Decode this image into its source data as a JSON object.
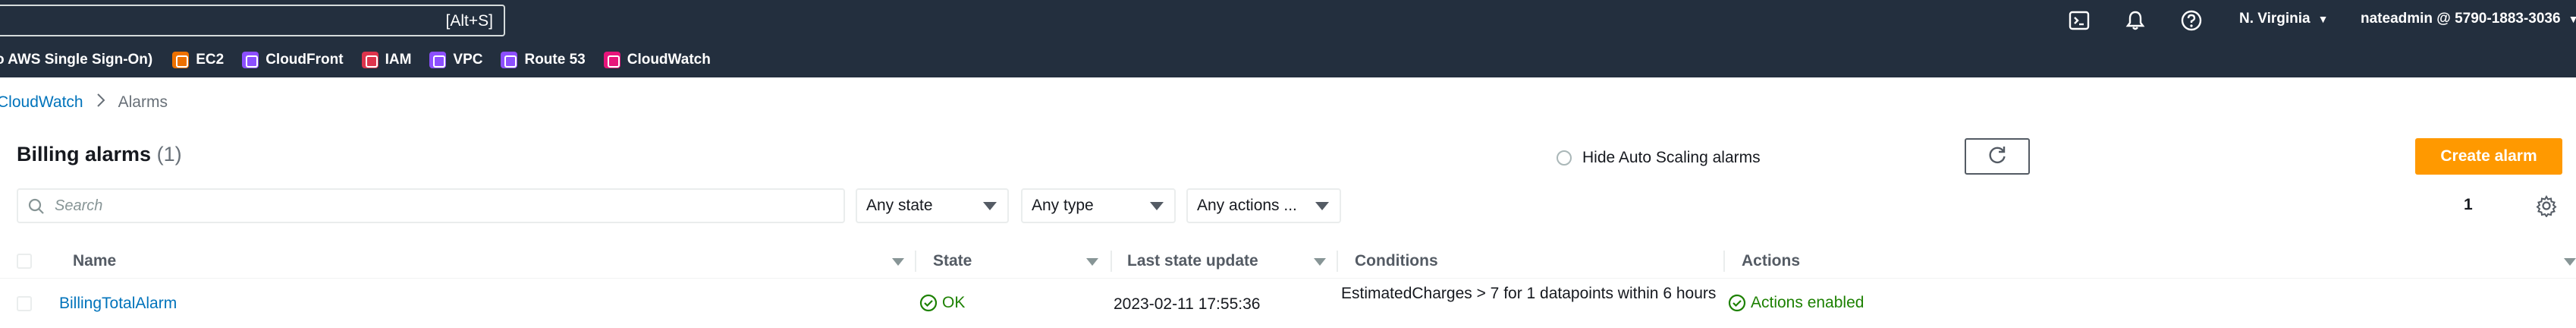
{
  "topnav": {
    "search_shortcut": "[Alt+S]",
    "region": "N. Virginia",
    "account": "nateadmin @ 5790-1883-3036"
  },
  "favorites": [
    {
      "label": "o AWS Single Sign-On)",
      "icon": "none",
      "color": ""
    },
    {
      "label": "EC2",
      "icon": "ec2-icon",
      "color": "#ed7100"
    },
    {
      "label": "CloudFront",
      "icon": "cloudfront-icon",
      "color": "#8c4fff"
    },
    {
      "label": "IAM",
      "icon": "iam-icon",
      "color": "#dd344c"
    },
    {
      "label": "VPC",
      "icon": "vpc-icon",
      "color": "#8c4fff"
    },
    {
      "label": "Route 53",
      "icon": "route53-icon",
      "color": "#8c4fff"
    },
    {
      "label": "CloudWatch",
      "icon": "cloudwatch-icon",
      "color": "#e7157b"
    }
  ],
  "breadcrumb": {
    "parent": "CloudWatch",
    "current": "Alarms"
  },
  "header": {
    "title": "Billing alarms",
    "count": "(1)",
    "hide_autoscaling_label": "Hide Auto Scaling alarms",
    "create_button": "Create alarm"
  },
  "filters": {
    "search_placeholder": "Search",
    "state": "Any state",
    "type": "Any type",
    "actions": "Any actions ...",
    "page": "1"
  },
  "table": {
    "columns": [
      "Name",
      "State",
      "Last state update",
      "Conditions",
      "Actions"
    ],
    "rows": [
      {
        "name": "BillingTotalAlarm",
        "state": "OK",
        "last_update": "2023-02-11 17:55:36",
        "conditions": "EstimatedCharges > 7 for 1 datapoints within 6 hours",
        "actions": "Actions enabled"
      }
    ]
  },
  "colors": {
    "nav_bg": "#232f3e",
    "link": "#0073bb",
    "primary": "#ff9900",
    "success": "#1d8102"
  }
}
